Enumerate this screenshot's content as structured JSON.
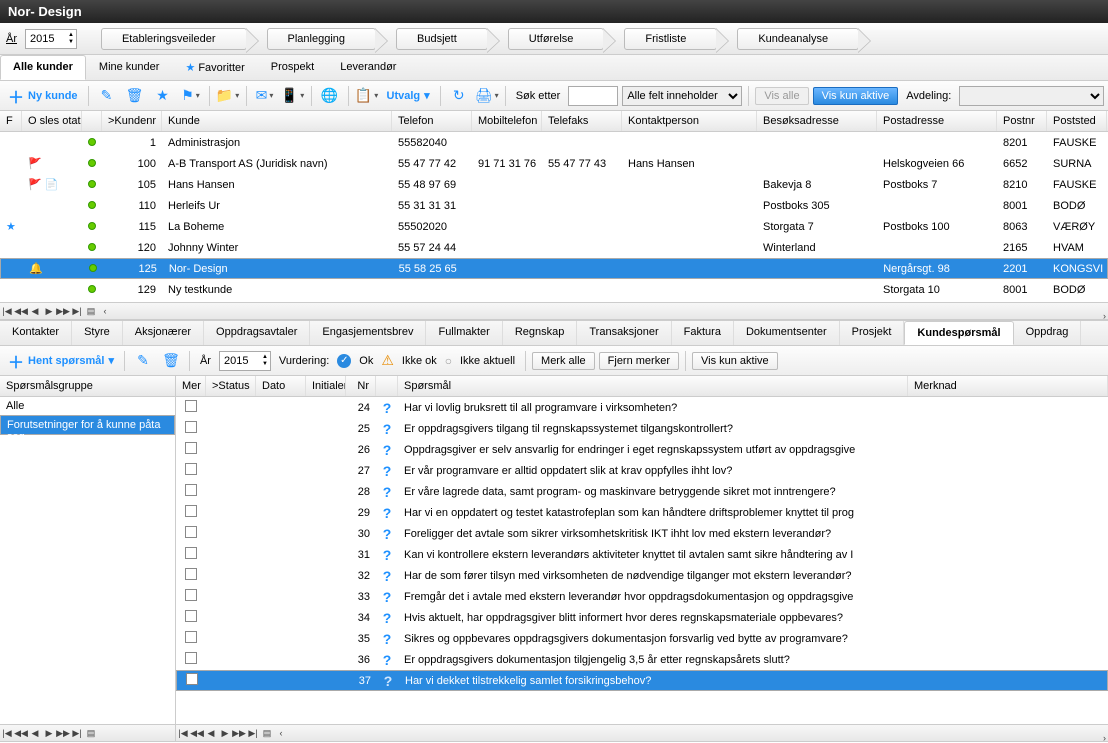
{
  "window_title": "Nor- Design",
  "year_label": "År",
  "year_value": "2015",
  "process_tabs": [
    "Etableringsveileder",
    "Planlegging",
    "Budsjett",
    "Utførelse",
    "Fristliste",
    "Kundeanalyse"
  ],
  "customer_tabs": [
    {
      "label": "Alle kunder",
      "active": true
    },
    {
      "label": "Mine kunder"
    },
    {
      "label": "Favoritter",
      "star": true
    },
    {
      "label": "Prospekt"
    },
    {
      "label": "Leverandør"
    }
  ],
  "toolbar": {
    "new_customer": "Ny kunde",
    "utvalg": "Utvalg",
    "search_label": "Søk etter",
    "filter_field": "Alle felt inneholder",
    "vis_alle": "Vis alle",
    "vis_kun_aktive": "Vis kun aktive",
    "avdeling": "Avdeling:"
  },
  "columns": {
    "f": "F",
    "osles": "O sles otat",
    "knr": ">Kundenr",
    "kunde": "Kunde",
    "telefon": "Telefon",
    "mobil": "Mobiltelefon",
    "telefaks": "Telefaks",
    "kontakt": "Kontaktperson",
    "besok": "Besøksadresse",
    "post": "Postadresse",
    "postnr": "Postnr",
    "poststed": "Poststed"
  },
  "rows": [
    {
      "status": "g",
      "knr": "1",
      "kunde": "Administrasjon",
      "telefon": "55582040",
      "postnr": "8201",
      "poststed": "FAUSKE"
    },
    {
      "flag": "🚩",
      "status": "g",
      "knr": "100",
      "kunde": "A-B Transport AS (Juridisk navn)",
      "telefon": "55 47 77 42",
      "mobil": "91 71 31 76",
      "telefaks": "55 47 77 43",
      "kontakt": "Hans Hansen",
      "post": "Helskogveien 66",
      "postnr": "6652",
      "poststed": "SURNA"
    },
    {
      "flag": "🚩",
      "note": "📄",
      "status": "g",
      "knr": "105",
      "kunde": "Hans Hansen",
      "telefon": "55 48 97 69",
      "besok": "Bakevja 8",
      "post": "Postboks 7",
      "postnr": "8210",
      "poststed": "FAUSKE"
    },
    {
      "status": "g",
      "knr": "110",
      "kunde": "Herleifs Ur",
      "telefon": "55 31 31 31",
      "besok": "Postboks 305",
      "postnr": "8001",
      "poststed": "BODØ"
    },
    {
      "fav": "★",
      "status": "g",
      "knr": "115",
      "kunde": "La Boheme",
      "telefon": "55502020",
      "besok": "Storgata 7",
      "post": "Postboks 100",
      "postnr": "8063",
      "poststed": "VÆRØY"
    },
    {
      "status": "g",
      "knr": "120",
      "kunde": "Johnny Winter",
      "telefon": "55 57 24 44",
      "besok": "Winterland",
      "postnr": "2165",
      "poststed": "HVAM"
    },
    {
      "bell": "🔔",
      "status": "g",
      "knr": "125",
      "kunde": "Nor- Design",
      "telefon": "55 58 25 65",
      "post": "Nergårsgt. 98",
      "postnr": "2201",
      "poststed": "KONGSVI",
      "selected": true
    },
    {
      "status": "g",
      "knr": "129",
      "kunde": "Ny testkunde",
      "post": "Storgata 10",
      "postnr": "8001",
      "poststed": "BODØ"
    }
  ],
  "bottom_tabs": [
    "Kontakter",
    "Styre",
    "Aksjonærer",
    "Oppdragsavtaler",
    "Engasjementsbrev",
    "Fullmakter",
    "Regnskap",
    "Transaksjoner",
    "Faktura",
    "Dokumentsenter",
    "Prosjekt",
    "Kundespørsmål",
    "Oppdrag"
  ],
  "bottom_active": "Kundespørsmål",
  "sp_toolbar": {
    "hent": "Hent spørsmål",
    "ar": "År",
    "ar_val": "2015",
    "vurdering": "Vurdering:",
    "ok": "Ok",
    "ikke_ok": "Ikke ok",
    "ikke_aktuell": "Ikke aktuell",
    "merk_alle": "Merk alle",
    "fjern": "Fjern merker",
    "vis_kun": "Vis kun aktive"
  },
  "sp_left_header": "Spørsmålsgruppe",
  "sp_groups": [
    {
      "label": "Alle"
    },
    {
      "label": "Forutsetninger for å kunne påta seg",
      "selected": true
    }
  ],
  "sp_columns": {
    "mer": "Mer",
    "status": ">Status",
    "dato": "Dato",
    "init": "Initialer",
    "nr": "Nr",
    "sporsmal": "Spørsmål",
    "merknad": "Merknad"
  },
  "questions": [
    {
      "nr": 24,
      "text": "Har vi lovlig bruksrett til all programvare i virksomheten?"
    },
    {
      "nr": 25,
      "text": "Er oppdragsgivers tilgang til regnskapssystemet tilgangskontrollert?"
    },
    {
      "nr": 26,
      "text": "Oppdragsgiver er selv ansvarlig for endringer i eget regnskapssystem utført av oppdragsgive"
    },
    {
      "nr": 27,
      "text": "Er vår programvare er alltid oppdatert slik at krav oppfylles ihht lov?"
    },
    {
      "nr": 28,
      "text": "Er våre lagrede data, samt program- og maskinvare betryggende sikret mot inntrengere?"
    },
    {
      "nr": 29,
      "text": "Har vi en oppdatert og testet katastrofeplan som kan håndtere driftsproblemer knyttet til prog"
    },
    {
      "nr": 30,
      "text": "Foreligger det avtale som sikrer virksomhetskritisk IKT ihht lov med ekstern leverandør?"
    },
    {
      "nr": 31,
      "text": "Kan vi kontrollere ekstern leverandørs aktiviteter knyttet til avtalen samt sikre håndtering av I"
    },
    {
      "nr": 32,
      "text": "Har de som fører tilsyn med virksomheten de nødvendige tilganger mot ekstern leverandør?"
    },
    {
      "nr": 33,
      "text": "Fremgår det i avtale med ekstern leverandør hvor oppdragsdokumentasjon og oppdragsgive"
    },
    {
      "nr": 34,
      "text": "Hvis aktuelt, har oppdragsgiver blitt informert hvor deres regnskapsmateriale oppbevares?"
    },
    {
      "nr": 35,
      "text": "Sikres og oppbevares oppdragsgivers dokumentasjon forsvarlig ved bytte av programvare?"
    },
    {
      "nr": 36,
      "text": "Er oppdragsgivers dokumentasjon tilgjengelig 3,5 år etter regnskapsårets slutt?"
    },
    {
      "nr": 37,
      "text": "Har vi dekket tilstrekkelig samlet forsikringsbehov?",
      "selected": true
    }
  ]
}
